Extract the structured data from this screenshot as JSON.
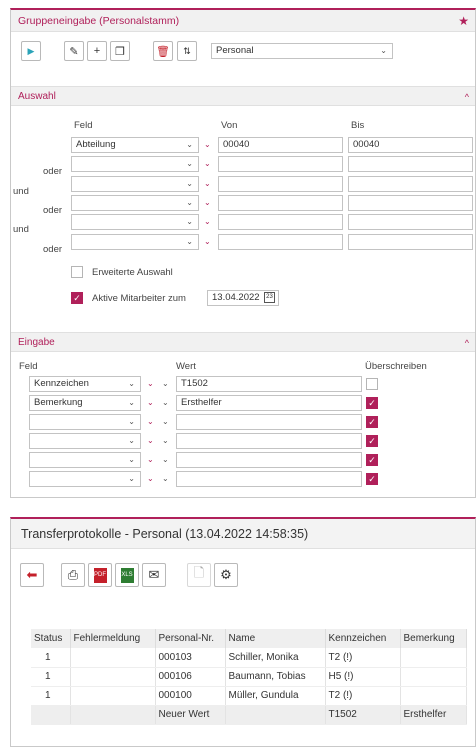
{
  "panel1": {
    "title": "Gruppeneingabe (Personalstamm)",
    "toolbar_select": "Personal",
    "auswahl_title": "Auswahl",
    "headers": {
      "feld": "Feld",
      "von": "Von",
      "bis": "Bis"
    },
    "rows": [
      {
        "conj": "",
        "conj2": "",
        "field": "Abteilung",
        "von": "00040",
        "bis": "00040"
      },
      {
        "conj": "oder",
        "conj2": "",
        "field": "",
        "von": "",
        "bis": ""
      },
      {
        "conj": "",
        "conj2": "und",
        "field": "",
        "von": "",
        "bis": ""
      },
      {
        "conj": "oder",
        "conj2": "",
        "field": "",
        "von": "",
        "bis": ""
      },
      {
        "conj": "",
        "conj2": "und",
        "field": "",
        "von": "",
        "bis": ""
      },
      {
        "conj": "oder",
        "conj2": "",
        "field": "",
        "von": "",
        "bis": ""
      }
    ],
    "erweiterte_auswahl": "Erweiterte Auswahl",
    "aktive_mitarbeiter": "Aktive Mitarbeiter zum",
    "aktive_date": "13.04.2022",
    "eingabe_title": "Eingabe",
    "eingabe_headers": {
      "feld": "Feld",
      "wert": "Wert",
      "ueberschreiben": "Überschreiben"
    },
    "eingabe_rows": [
      {
        "field": "Kennzeichen",
        "wert": "T1502",
        "checked": false
      },
      {
        "field": "Bemerkung",
        "wert": "Ersthelfer",
        "checked": true
      },
      {
        "field": "",
        "wert": "",
        "checked": true
      },
      {
        "field": "",
        "wert": "",
        "checked": true
      },
      {
        "field": "",
        "wert": "",
        "checked": true
      },
      {
        "field": "",
        "wert": "",
        "checked": true
      }
    ]
  },
  "panel2": {
    "title": "Transferprotokolle - Personal (13.04.2022 14:58:35)",
    "columns": [
      "Status",
      "Fehlermeldung",
      "Personal-Nr.",
      "Name",
      "Kennzeichen",
      "Bemerkung"
    ],
    "rows": [
      [
        "1",
        "",
        "000103",
        "Schiller, Monika",
        "T2 (!)",
        ""
      ],
      [
        "1",
        "",
        "000106",
        "Baumann, Tobias",
        "H5 (!)",
        ""
      ],
      [
        "1",
        "",
        "000100",
        "Müller, Gundula",
        "T2 (!)",
        ""
      ],
      [
        "",
        "",
        "Neuer Wert",
        "",
        "T1502",
        "Ersthelfer"
      ]
    ]
  },
  "colors": {
    "accent": "#b0205a",
    "header_bg": "#f1f1f1",
    "play": "#2aa3b8"
  },
  "icons": [
    "play-icon",
    "pencil-icon",
    "plus-icon",
    "copy-icon",
    "trash-icon",
    "sort-icon",
    "star-icon",
    "calendar-icon",
    "back-arrow-icon",
    "printer-icon",
    "pdf-icon",
    "excel-icon",
    "mail-icon",
    "document-icon",
    "gear-icon"
  ]
}
